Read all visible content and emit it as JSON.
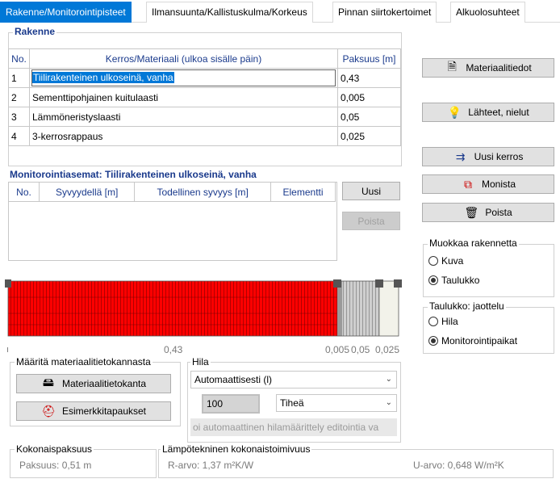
{
  "tabs": [
    {
      "label": "Rakenne/Monitorointipisteet",
      "active": true
    },
    {
      "label": "Ilmansuunta/Kallistuskulma/Korkeus"
    },
    {
      "label": "Pinnan siirtokertoimet"
    },
    {
      "label": "Alkuolosuhteet"
    }
  ],
  "rakenne": {
    "title": "Rakenne",
    "headers": {
      "no": "No.",
      "material": "Kerros/Materiaali (ulkoa sisälle päin)",
      "thickness": "Paksuus [m]"
    },
    "rows": [
      {
        "no": "1",
        "material": "Tiilirakenteinen ulkoseinä, vanha",
        "thickness": "0,43"
      },
      {
        "no": "2",
        "material": "Sementtipohjainen kuitulaasti",
        "thickness": "0,005"
      },
      {
        "no": "3",
        "material": "Lämmöneristyslaasti",
        "thickness": "0,05"
      },
      {
        "no": "4",
        "material": "3-kerrosrappaus",
        "thickness": "0,025"
      }
    ]
  },
  "monitoring": {
    "title": "Monitorointiasemat: Tiilirakenteinen ulkoseinä, vanha",
    "headers": {
      "no": "No.",
      "depth": "Syvyydellä [m]",
      "actual": "Todellinen syvyys [m]",
      "element": "Elementti"
    },
    "new_button": "Uusi",
    "delete_button": "Poista"
  },
  "right_buttons": {
    "materials": "Materiaalitiedot",
    "sources": "Lähteet, nielut",
    "new_layer": "Uusi kerros",
    "duplicate": "Monista",
    "delete": "Poista"
  },
  "edit_structure": {
    "title": "Muokkaa rakennetta",
    "options": [
      "Kuva",
      "Taulukko"
    ],
    "selected": "Taulukko"
  },
  "table_division": {
    "title": "Taulukko: jaottelu",
    "options": [
      "Hila",
      "Monitorointipaikat"
    ],
    "selected": "Monitorointipaikat"
  },
  "layer_labels": {
    "l1": "0,43",
    "l2": "0,005",
    "l3": "0,05",
    "l4": "0,025"
  },
  "material_db": {
    "title": "Määritä materiaalitietokannasta",
    "db_button": "Materiaalitietokanta",
    "examples_button": "Esimerkkitapaukset"
  },
  "grid": {
    "title": "Hila",
    "mode": "Automaattisesti (l)",
    "count": "100",
    "density": "Tiheä",
    "info": "oi automaattinen hilamäärittely editointia va"
  },
  "totals": {
    "thickness_title": "Kokonaispaksuus",
    "thickness": "Paksuus: 0,51 m",
    "thermal_title": "Lämpötekninen kokonaistoimivuus",
    "r_value": "R-arvo: 1,37 m²K/W",
    "u_value": "U-arvo: 0,648 W/m²K"
  },
  "colors": {
    "brick": "#ff0000",
    "mortar": "#b4b4b4",
    "insulation": "#e0e0e0",
    "render": "#f5f5f0",
    "accent": "#0078d7"
  }
}
